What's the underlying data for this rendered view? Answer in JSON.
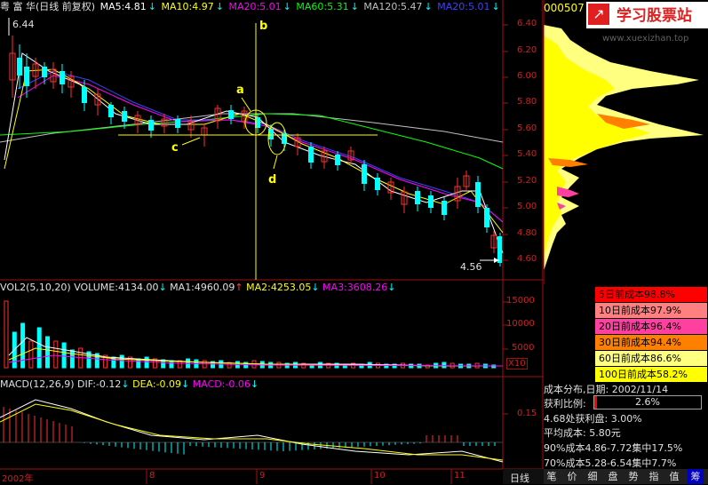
{
  "header": {
    "title": "粤 富 华(日线 前复权)",
    "ma5": "MA5:4.81",
    "ma10": "MA10:4.97",
    "ma20": "MA20:5.01",
    "ma60": "MA60:5.31",
    "ma120": "MA120:5.47",
    "ma20b": "MA20:5.01"
  },
  "colors": {
    "ma5": "#ffffff",
    "ma10": "#ffff00",
    "ma20": "#ff00ff",
    "ma60": "#00ff00",
    "ma120": "#c0c0c0",
    "ma20b": "#4040ff",
    "up": "#ff3030",
    "down": "#00ffff",
    "axis": "#d02020"
  },
  "price_axis": [
    "6.40",
    "6.20",
    "6.00",
    "5.80",
    "5.60",
    "5.40",
    "5.20",
    "5.00",
    "4.80",
    "4.60"
  ],
  "annotations": {
    "high": "6.44",
    "low": "4.56",
    "a": "a",
    "b": "b",
    "c": "c",
    "d": "d"
  },
  "volume": {
    "label": "VOL2(5,10,20)",
    "volume": "VOLUME:4134.00",
    "ma1": "MA1:4960.09",
    "ma2": "MA2:4253.05",
    "ma3": "MA3:3608.26",
    "axis": [
      "15000",
      "10000",
      "5000"
    ],
    "unit": "X10"
  },
  "macd": {
    "label": "MACD(12,26,9)",
    "dif": "DIF:-0.12",
    "dea": "DEA:-0.09",
    "macd": "MACD:-0.06",
    "axis": [
      "0.15"
    ]
  },
  "dates": {
    "year": "2002年",
    "m8": "8",
    "m9": "9",
    "m10": "10",
    "m11": "11"
  },
  "bottom_tab": "日线",
  "stock_code": "000507",
  "watermark": {
    "brand": "学习股票站",
    "url": "www.xuexizhan.top"
  },
  "cost_legend": [
    {
      "label": "5日前成本98.8%",
      "color": "#ff0000"
    },
    {
      "label": "10日前成本97.9%",
      "color": "#ff8080"
    },
    {
      "label": "20日前成本96.4%",
      "color": "#ff40a0"
    },
    {
      "label": "30日前成本94.4%",
      "color": "#ff8000"
    },
    {
      "label": "60日前成本86.6%",
      "color": "#ffff80"
    },
    {
      "label": "100日前成本58.2%",
      "color": "#ffff00"
    }
  ],
  "info": {
    "dist_date": "成本分布,日期:  2002/11/14",
    "profit_label": "获利比例:",
    "profit_value": "2.6%",
    "profit_at": "4.68处获利盘:  3.00%",
    "avg_cost": "平均成本:  5.80元",
    "c90": "90%成本4.86-7.72集中17.5%",
    "c70": "70%成本5.28-6.54集中7.7%"
  },
  "tabs": [
    "笔",
    "价",
    "细",
    "盘",
    "势",
    "指",
    "值",
    "筹"
  ]
}
